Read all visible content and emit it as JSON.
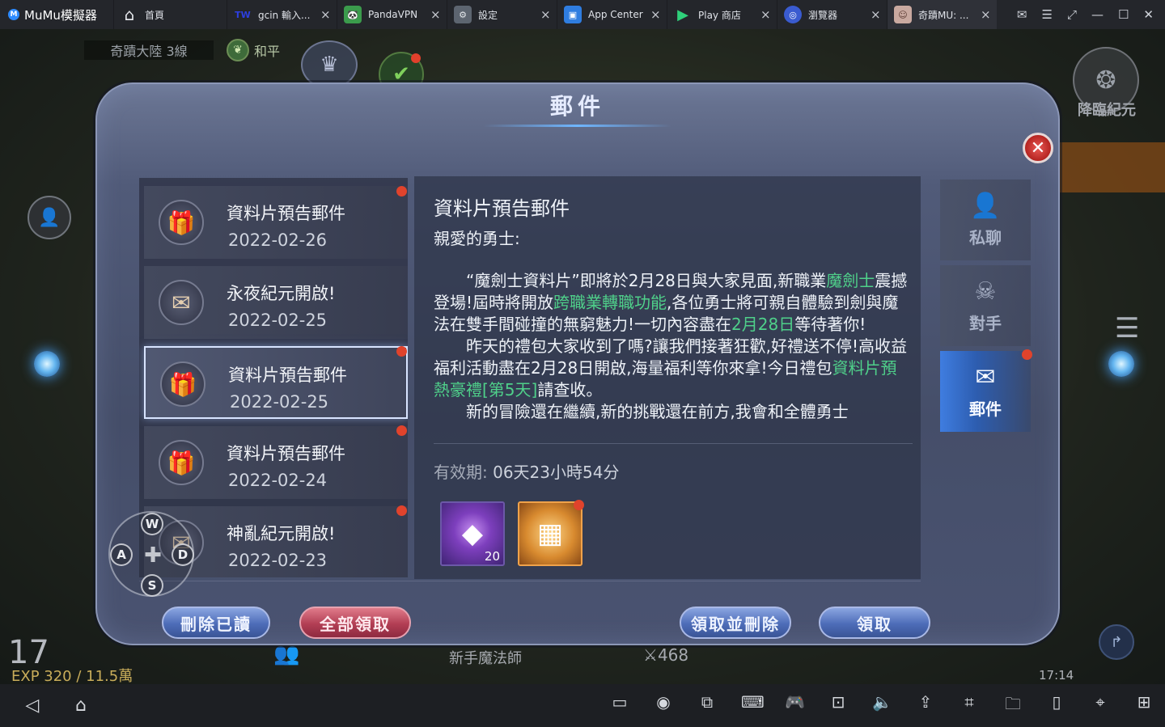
{
  "topbar": {
    "brand": "MuMu模擬器",
    "home_tab": "首頁",
    "tabs": [
      {
        "label": "gcin 輸入...",
        "icon": "tw-icon",
        "active": false
      },
      {
        "label": "PandaVPN",
        "icon": "panda-icon",
        "active": false
      },
      {
        "label": "設定",
        "icon": "gear-icon",
        "active": false
      },
      {
        "label": "App Center",
        "icon": "app-center-icon",
        "active": false
      },
      {
        "label": "Play 商店",
        "icon": "play-store-icon",
        "active": false
      },
      {
        "label": "瀏覽器",
        "icon": "browser-icon",
        "active": false
      },
      {
        "label": "奇蹟MU: ...",
        "icon": "game-avatar-icon",
        "active": true
      }
    ],
    "tw_badge": "TW"
  },
  "game": {
    "server": "奇蹟大陸 3線",
    "mode": "和平",
    "side_emblem_label": "降臨紀元",
    "level": "17",
    "exp": "EXP 320 / 11.5萬",
    "mid_label": "新手魔法師",
    "kills": "468",
    "clock": "17:14"
  },
  "mail": {
    "title": "郵件",
    "items": [
      {
        "title": "資料片預告郵件",
        "date": "2022-02-26",
        "icon": "gift-icon",
        "unread": true,
        "selected": false
      },
      {
        "title": "永夜紀元開啟!",
        "date": "2022-02-25",
        "icon": "envelope-icon",
        "unread": false,
        "selected": false
      },
      {
        "title": "資料片預告郵件",
        "date": "2022-02-25",
        "icon": "gift-icon",
        "unread": true,
        "selected": true
      },
      {
        "title": "資料片預告郵件",
        "date": "2022-02-24",
        "icon": "gift-icon",
        "unread": true,
        "selected": false
      },
      {
        "title": "神亂紀元開啟!",
        "date": "2022-02-23",
        "icon": "envelope-icon",
        "unread": true,
        "selected": false
      }
    ],
    "content": {
      "title": "資料片預告郵件",
      "greeting": "親愛的勇士:",
      "p1_a": "“魔劍士資料片”即將於2月28日與大家見面,新職業",
      "p1_hl1": "魔劍士",
      "p1_b": "震撼登場!屆時將開放",
      "p1_hl2": "跨職業轉職功能",
      "p1_c": ",各位勇士將可親自體驗到劍與魔法在雙手間碰撞的無窮魅力!一切內容盡在",
      "p1_hl3": "2月28日",
      "p1_d": "等待著你!",
      "p2_a": "昨天的禮包大家收到了嗎?讓我們接著狂歡,好禮送不停!高收益福利活動盡在2月28日開啟,海量福利等你來拿!今日禮包",
      "p2_hl": "資料片預熱豪禮[第5天]",
      "p2_b": "請查收。",
      "p3": "新的冒險還在繼續,新的挑戰還在前方,我會和全體勇士",
      "validity_label": "有效期:",
      "validity_value": "06天23小時54分",
      "rewards": [
        {
          "icon": "purple-gem-icon",
          "count": "20",
          "unread": false
        },
        {
          "icon": "gold-chest-icon",
          "count": "",
          "unread": true
        }
      ]
    },
    "side_tabs": [
      {
        "label": "私聊",
        "icon": "person-icon",
        "active": false,
        "dot": false
      },
      {
        "label": "對手",
        "icon": "skull-icon",
        "active": false,
        "dot": false
      },
      {
        "label": "郵件",
        "icon": "mail-icon",
        "active": true,
        "dot": true
      }
    ],
    "buttons": {
      "delete_read": "刪除已讀",
      "claim_all": "全部領取",
      "claim_delete": "領取並刪除",
      "claim": "領取"
    },
    "dpad": {
      "up": "W",
      "left": "A",
      "right": "D",
      "down": "S"
    }
  }
}
